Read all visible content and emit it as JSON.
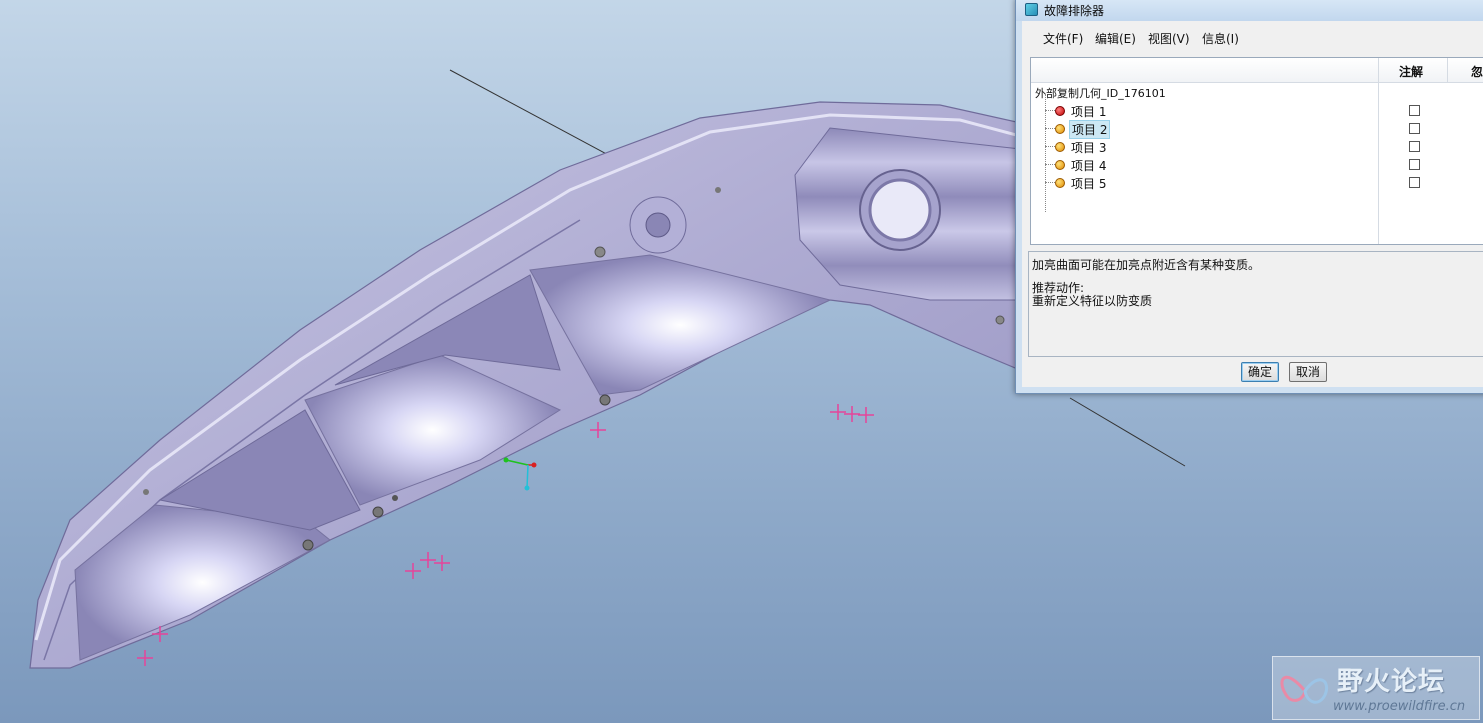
{
  "dialog": {
    "title": "故障排除器",
    "menu": [
      "文件(F)",
      "编辑(E)",
      "视图(V)",
      "信息(I)"
    ],
    "columns": [
      "注解",
      "忽"
    ],
    "root": "外部复制几何_ID_176101",
    "items": [
      {
        "label": "项目 1",
        "status": "error",
        "selected": false
      },
      {
        "label": "项目 2",
        "status": "warning",
        "selected": true
      },
      {
        "label": "项目 3",
        "status": "warning",
        "selected": false
      },
      {
        "label": "项目 4",
        "status": "warning",
        "selected": false
      },
      {
        "label": "项目 5",
        "status": "warning",
        "selected": false
      }
    ],
    "message": "加亮曲面可能在加亮点附近含有某种变质。",
    "recommend_label": "推荐动作:",
    "recommend_text": "重新定义特征以防变质",
    "ok_label": "确定",
    "cancel_label": "取消"
  },
  "watermark": {
    "title": "野火论坛",
    "url": "www.proewildfire.cn"
  },
  "colors": {
    "part_fill": "#b7b5d6",
    "datum_point": "#e6449a",
    "viewport_top": "#c3d6e8",
    "viewport_bottom": "#7b98bc"
  }
}
